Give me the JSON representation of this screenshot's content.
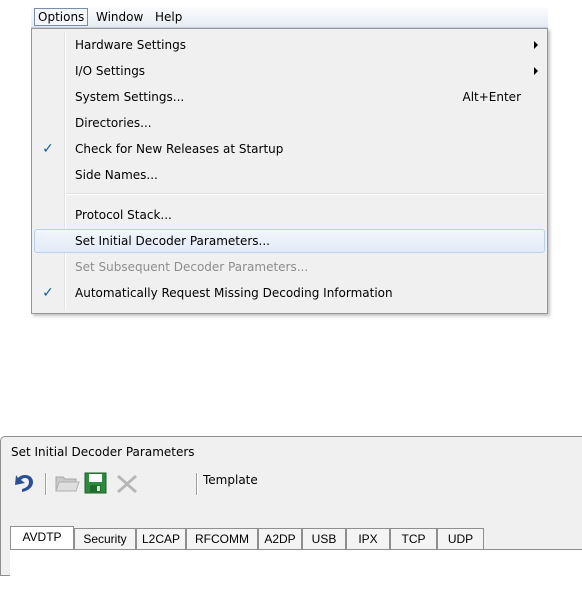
{
  "menubar": {
    "items": [
      "Options",
      "Window",
      "Help"
    ]
  },
  "menu": {
    "items": [
      {
        "label": "Hardware Settings",
        "submenu": true
      },
      {
        "label": "I/O Settings",
        "submenu": true
      },
      {
        "label": "System Settings...",
        "shortcut": "Alt+Enter"
      },
      {
        "label": "Directories..."
      },
      {
        "label": "Check for New Releases at Startup",
        "checked": true
      },
      {
        "label": "Side Names..."
      },
      {
        "label": "Protocol Stack..."
      },
      {
        "label": "Set Initial Decoder Parameters...",
        "highlighted": true
      },
      {
        "label": "Set Subsequent Decoder Parameters...",
        "disabled": true
      },
      {
        "label": "Automatically Request Missing Decoding Information",
        "checked": true
      }
    ],
    "checkmark": "✓"
  },
  "dialog": {
    "title": "Set Initial Decoder Parameters",
    "toolbar": {
      "buttons": [
        "undo-icon",
        "open-folder-icon",
        "save-icon",
        "delete-icon"
      ],
      "template_label": "Template"
    },
    "tabs": [
      "AVDTP",
      "Security",
      "L2CAP",
      "RFCOMM",
      "A2DP",
      "USB",
      "IPX",
      "TCP",
      "UDP"
    ],
    "active_tab": "AVDTP"
  }
}
